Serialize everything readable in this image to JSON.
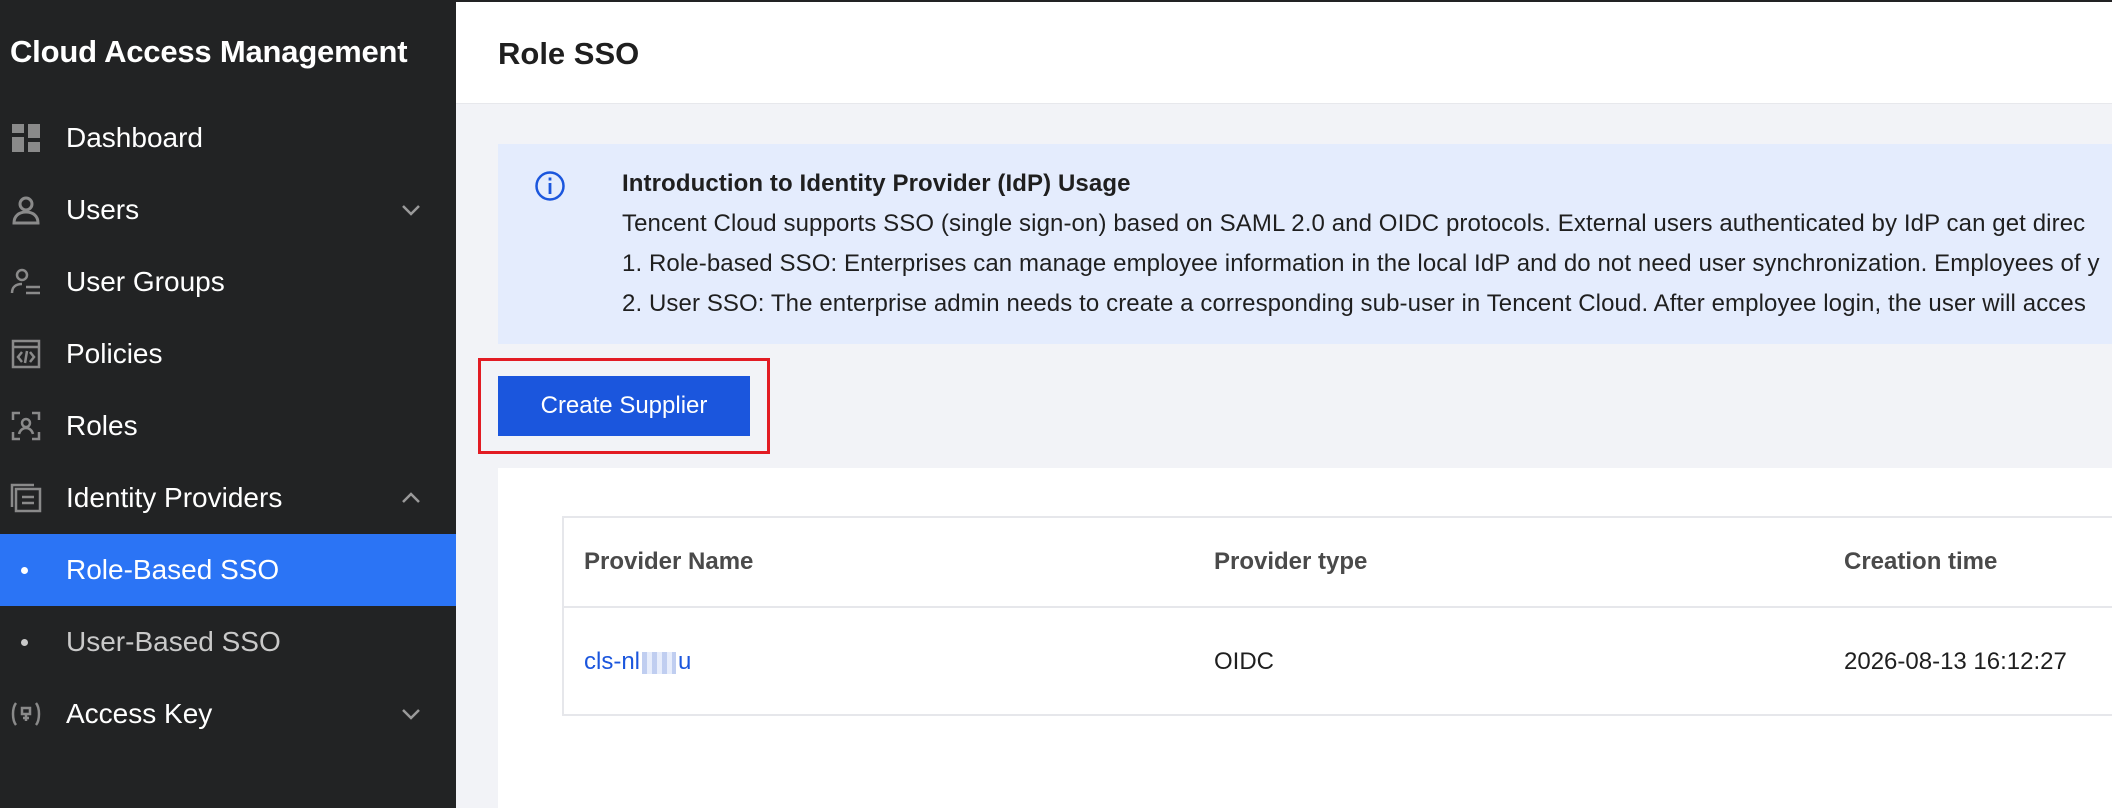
{
  "sidebar": {
    "title": "Cloud Access Management",
    "items": [
      {
        "label": "Dashboard",
        "icon": "dashboard-icon"
      },
      {
        "label": "Users",
        "icon": "user-icon",
        "chevron": "down"
      },
      {
        "label": "User Groups",
        "icon": "user-groups-icon"
      },
      {
        "label": "Policies",
        "icon": "policy-icon"
      },
      {
        "label": "Roles",
        "icon": "role-icon"
      },
      {
        "label": "Identity Providers",
        "icon": "identity-provider-icon",
        "chevron": "up"
      },
      {
        "label": "Role-Based SSO",
        "sub": true,
        "active": true
      },
      {
        "label": "User-Based SSO",
        "sub": true
      },
      {
        "label": "Access Key",
        "icon": "access-key-icon",
        "chevron": "down"
      }
    ]
  },
  "header": {
    "title": "Role SSO"
  },
  "notice": {
    "heading": "Introduction to Identity Provider (IdP) Usage",
    "line1": "Tencent Cloud supports SSO (single sign-on) based on SAML 2.0 and OIDC protocols. External users authenticated by IdP can get direc",
    "line2": "1. Role-based SSO: Enterprises can manage employee information in the local IdP and do not need user synchronization. Employees of y",
    "line3": "2. User SSO: The enterprise admin needs to create a corresponding sub-user in Tencent Cloud. After employee login, the user will acces"
  },
  "toolbar": {
    "create_label": "Create Supplier"
  },
  "table": {
    "columns": [
      "Provider Name",
      "Provider type",
      "Creation time"
    ],
    "rows": [
      {
        "name_prefix": "cls-nl",
        "name_suffix": "u",
        "type": "OIDC",
        "created": "2026-08-13 16:12:27"
      }
    ]
  },
  "colors": {
    "sidebar_bg": "#222324",
    "active_bg": "#2b74f5",
    "primary": "#1b56dd",
    "highlight": "#e21b23",
    "notice_bg": "#e4ecfd"
  }
}
